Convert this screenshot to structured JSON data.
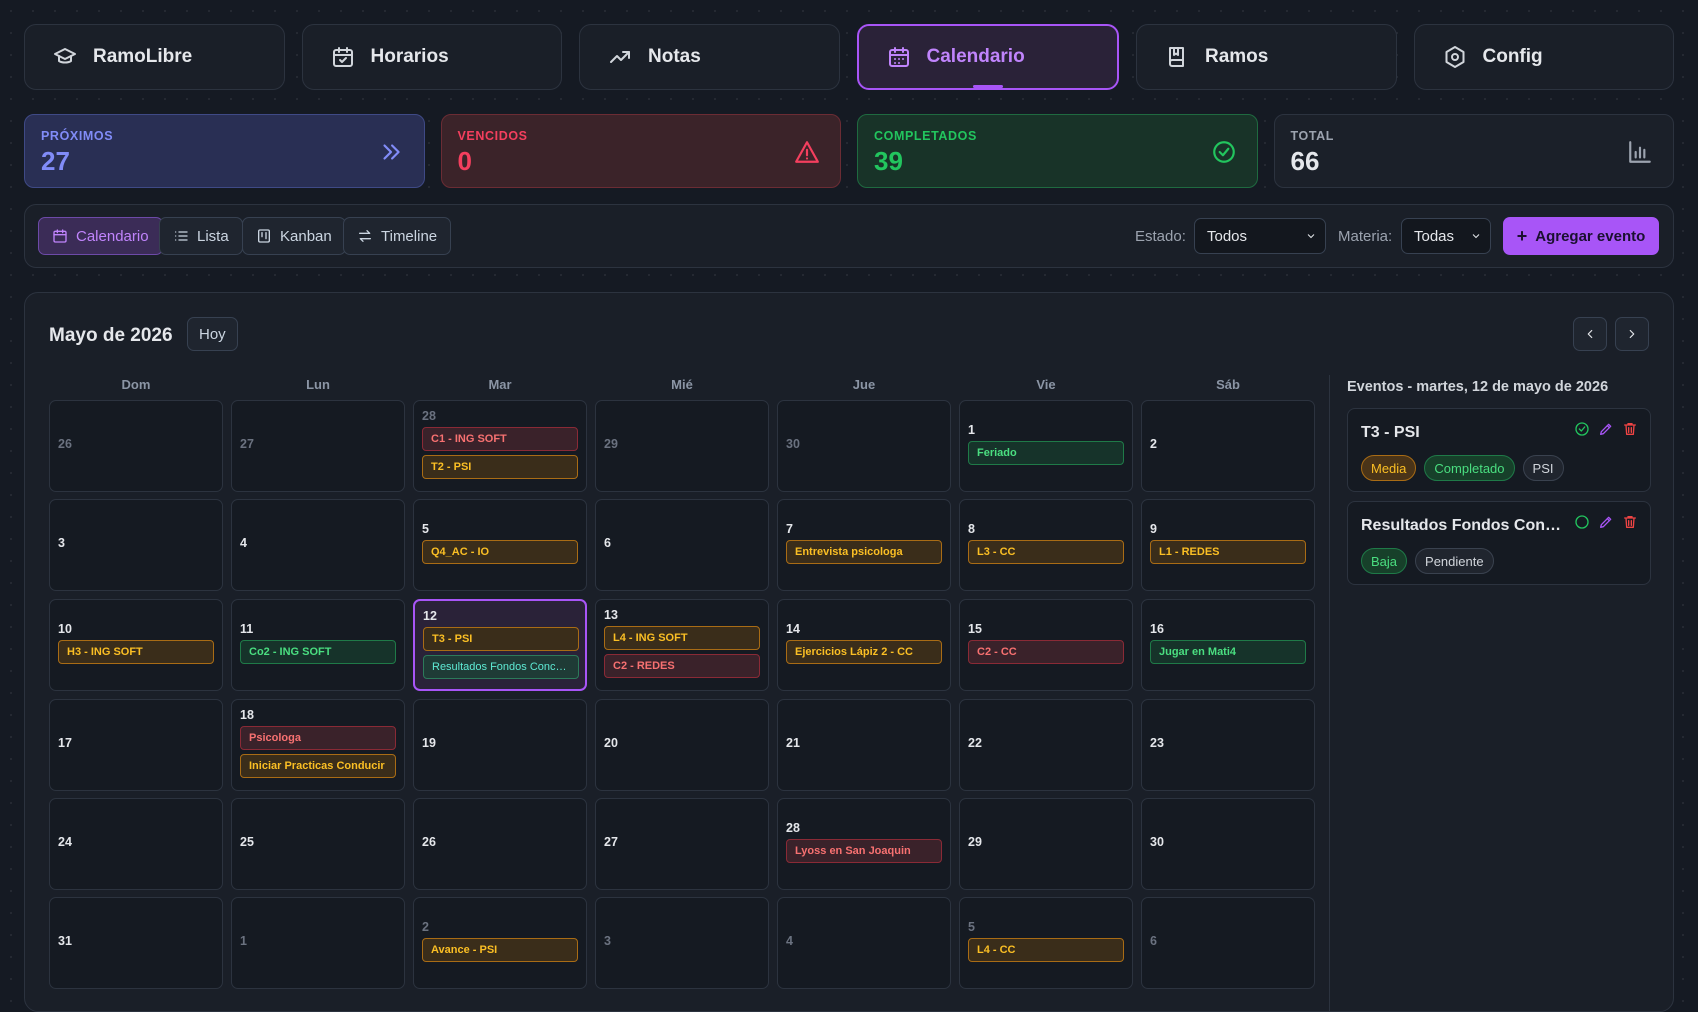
{
  "nav": [
    {
      "label": "RamoLibre",
      "icon": "graduation-cap-icon",
      "active": false
    },
    {
      "label": "Horarios",
      "icon": "calendar-check-icon",
      "active": false
    },
    {
      "label": "Notas",
      "icon": "trending-up-icon",
      "active": false
    },
    {
      "label": "Calendario",
      "icon": "calendar-icon",
      "active": true
    },
    {
      "label": "Ramos",
      "icon": "book-icon",
      "active": false
    },
    {
      "label": "Config",
      "icon": "settings-icon",
      "active": false
    }
  ],
  "stats": {
    "proximos": {
      "label": "PRÓXIMOS",
      "value": "27",
      "icon": "chevrons-right-icon"
    },
    "vencidos": {
      "label": "VENCIDOS",
      "value": "0",
      "icon": "warning-icon"
    },
    "completados": {
      "label": "COMPLETADOS",
      "value": "39",
      "icon": "check-circle-icon"
    },
    "total": {
      "label": "TOTAL",
      "value": "66",
      "icon": "bar-chart-icon"
    }
  },
  "toolbar": {
    "views": [
      {
        "label": "Calendario",
        "icon": "calendar-icon",
        "active": true
      },
      {
        "label": "Lista",
        "icon": "list-icon",
        "active": false
      },
      {
        "label": "Kanban",
        "icon": "kanban-icon",
        "active": false
      },
      {
        "label": "Timeline",
        "icon": "arrows-icon",
        "active": false
      }
    ],
    "estado_label": "Estado:",
    "estado_value": "Todos",
    "materia_label": "Materia:",
    "materia_value": "Todas",
    "add_label": "Agregar evento",
    "add_icon": "plus-icon"
  },
  "calendar": {
    "month_title": "Mayo de 2026",
    "today_label": "Hoy",
    "weekdays": [
      "Dom",
      "Lun",
      "Mar",
      "Mié",
      "Jue",
      "Vie",
      "Sáb"
    ],
    "colors": {
      "red": "#f87171",
      "orange": "#fbbf24",
      "green": "#4ade80",
      "accent": "#a855f7"
    },
    "weeks": [
      [
        {
          "day": "26",
          "muted": true,
          "events": []
        },
        {
          "day": "27",
          "muted": true,
          "events": []
        },
        {
          "day": "28",
          "muted": true,
          "events": [
            {
              "text": "C1 - ING SOFT",
              "color": "red"
            },
            {
              "text": "T2 - PSI",
              "color": "orange"
            }
          ]
        },
        {
          "day": "29",
          "muted": true,
          "events": []
        },
        {
          "day": "30",
          "muted": true,
          "events": []
        },
        {
          "day": "1",
          "muted": false,
          "events": [
            {
              "text": "Feriado",
              "color": "green"
            }
          ]
        },
        {
          "day": "2",
          "muted": false,
          "events": []
        }
      ],
      [
        {
          "day": "3",
          "muted": false,
          "events": []
        },
        {
          "day": "4",
          "muted": false,
          "events": []
        },
        {
          "day": "5",
          "muted": false,
          "events": [
            {
              "text": "Q4_AC - IO",
              "color": "orange"
            }
          ]
        },
        {
          "day": "6",
          "muted": false,
          "events": []
        },
        {
          "day": "7",
          "muted": false,
          "events": [
            {
              "text": "Entrevista psicologa",
              "color": "orange"
            }
          ]
        },
        {
          "day": "8",
          "muted": false,
          "events": [
            {
              "text": "L3 - CC",
              "color": "orange"
            }
          ]
        },
        {
          "day": "9",
          "muted": false,
          "events": [
            {
              "text": "L1 - REDES",
              "color": "orange"
            }
          ]
        }
      ],
      [
        {
          "day": "10",
          "muted": false,
          "events": [
            {
              "text": "H3 - ING SOFT",
              "color": "orange"
            }
          ]
        },
        {
          "day": "11",
          "muted": false,
          "events": [
            {
              "text": "Co2 - ING SOFT",
              "color": "green"
            }
          ]
        },
        {
          "day": "12",
          "muted": false,
          "selected": true,
          "events": [
            {
              "text": "T3 - PSI",
              "color": "orange"
            },
            {
              "text": "Resultados Fondos Concursables",
              "color": "green2"
            }
          ]
        },
        {
          "day": "13",
          "muted": false,
          "events": [
            {
              "text": "L4 - ING SOFT",
              "color": "orange"
            },
            {
              "text": "C2 - REDES",
              "color": "red"
            }
          ]
        },
        {
          "day": "14",
          "muted": false,
          "events": [
            {
              "text": "Ejercicios Lápiz 2 - CC",
              "color": "orange"
            }
          ]
        },
        {
          "day": "15",
          "muted": false,
          "events": [
            {
              "text": "C2 - CC",
              "color": "red"
            }
          ]
        },
        {
          "day": "16",
          "muted": false,
          "events": [
            {
              "text": "Jugar en Mati4",
              "color": "green"
            }
          ]
        }
      ],
      [
        {
          "day": "17",
          "muted": false,
          "events": []
        },
        {
          "day": "18",
          "muted": false,
          "events": [
            {
              "text": "Psicologa",
              "color": "red"
            },
            {
              "text": "Iniciar Practicas Conducir",
              "color": "orange"
            }
          ]
        },
        {
          "day": "19",
          "muted": false,
          "events": []
        },
        {
          "day": "20",
          "muted": false,
          "events": []
        },
        {
          "day": "21",
          "muted": false,
          "events": []
        },
        {
          "day": "22",
          "muted": false,
          "events": []
        },
        {
          "day": "23",
          "muted": false,
          "events": []
        }
      ],
      [
        {
          "day": "24",
          "muted": false,
          "events": []
        },
        {
          "day": "25",
          "muted": false,
          "events": []
        },
        {
          "day": "26",
          "muted": false,
          "events": []
        },
        {
          "day": "27",
          "muted": false,
          "events": []
        },
        {
          "day": "28",
          "muted": false,
          "events": [
            {
              "text": "Lyoss en San Joaquin",
              "color": "red"
            }
          ]
        },
        {
          "day": "29",
          "muted": false,
          "events": []
        },
        {
          "day": "30",
          "muted": false,
          "events": []
        }
      ],
      [
        {
          "day": "31",
          "muted": false,
          "events": []
        },
        {
          "day": "1",
          "muted": true,
          "events": []
        },
        {
          "day": "2",
          "muted": true,
          "events": [
            {
              "text": "Avance - PSI",
              "color": "orange"
            }
          ]
        },
        {
          "day": "3",
          "muted": true,
          "events": []
        },
        {
          "day": "4",
          "muted": true,
          "events": []
        },
        {
          "day": "5",
          "muted": true,
          "events": [
            {
              "text": "L4 - CC",
              "color": "orange"
            }
          ]
        },
        {
          "day": "6",
          "muted": true,
          "events": []
        }
      ]
    ]
  },
  "sidebar": {
    "title": "Eventos - martes, 12 de mayo de 2026",
    "events": [
      {
        "title": "T3 - PSI",
        "badges": [
          {
            "text": "Media",
            "kind": "media"
          },
          {
            "text": "Completado",
            "kind": "comp"
          },
          {
            "text": "PSI",
            "kind": "grey"
          }
        ],
        "done": true
      },
      {
        "title": "Resultados Fondos Concursables",
        "badges": [
          {
            "text": "Baja",
            "kind": "baja"
          },
          {
            "text": "Pendiente",
            "kind": "grey"
          }
        ],
        "done": false
      }
    ]
  }
}
